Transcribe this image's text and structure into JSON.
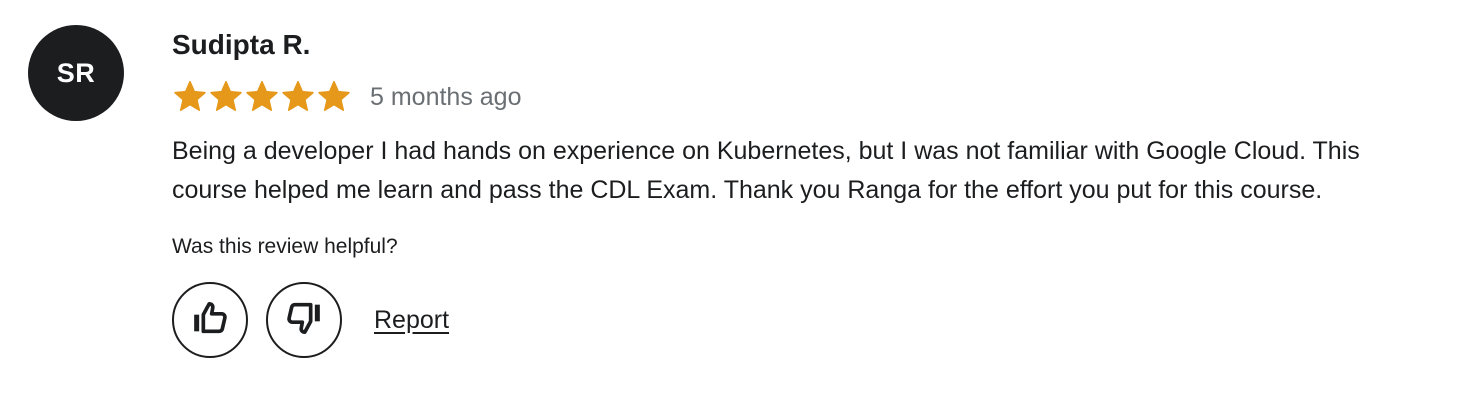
{
  "review": {
    "avatar_initials": "SR",
    "reviewer_name": "Sudipta R.",
    "rating": 5,
    "rating_max": 5,
    "star_color": "#e59819",
    "time_ago": "5 months ago",
    "text": "Being a developer I had hands on experience on Kubernetes, but I was not familiar with Google Cloud. This course helped me learn and pass the CDL Exam. Thank you Ranga for the effort you put for this course.",
    "helpful_prompt": "Was this review helpful?",
    "thumbs_up_icon": "thumbs-up-icon",
    "thumbs_down_icon": "thumbs-down-icon",
    "report_label": "Report"
  }
}
